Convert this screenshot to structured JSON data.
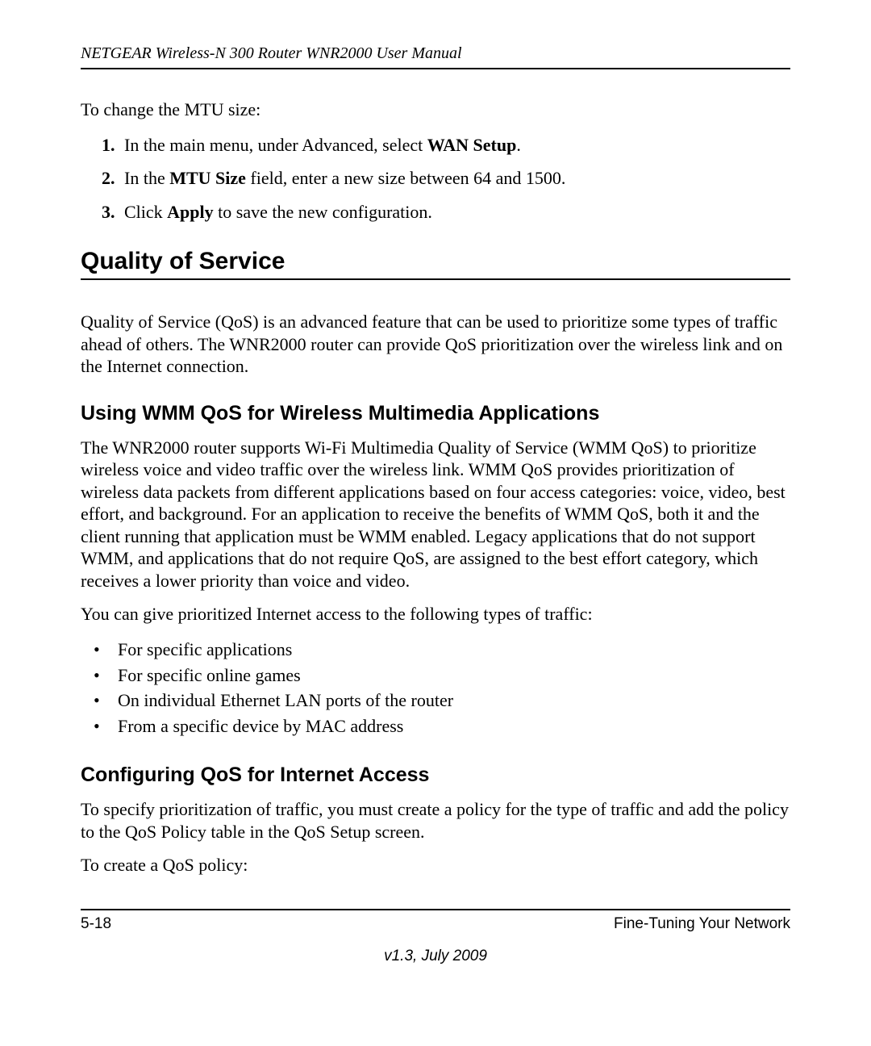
{
  "header": {
    "running_title": "NETGEAR Wireless-N 300 Router WNR2000 User Manual"
  },
  "intro": {
    "mtu_lead": "To change the MTU size:"
  },
  "steps": {
    "s1_pre": "In the main menu, under Advanced, select ",
    "s1_bold": "WAN Setup",
    "s1_post": ".",
    "s2_pre": "In the ",
    "s2_bold": "MTU Size",
    "s2_post": " field, enter a new size between 64 and 1500.",
    "s3_pre": "Click ",
    "s3_bold": "Apply",
    "s3_post": " to save the new configuration."
  },
  "qos": {
    "heading": "Quality of Service",
    "para": "Quality of Service (QoS) is an advanced feature that can be used to prioritize some types of traffic ahead of others. The WNR2000 router can provide QoS prioritization over the wireless link and on the Internet connection."
  },
  "wmm": {
    "heading": "Using WMM QoS for Wireless Multimedia Applications",
    "para1": "The WNR2000 router supports Wi-Fi Multimedia Quality of Service (WMM QoS) to prioritize wireless voice and video traffic over the wireless link. WMM QoS provides prioritization of wireless data packets from different applications based on four access categories: voice, video, best effort, and background. For an application to receive the benefits of WMM QoS, both it and the client running that application must be WMM enabled. Legacy applications that do not support WMM, and applications that do not require QoS, are assigned to the best effort category, which receives a lower priority than voice and video.",
    "para2": "You can give prioritized Internet access to the following types of traffic:",
    "bullets": [
      "For specific applications",
      "For specific online games",
      "On individual Ethernet LAN ports of the router",
      "From a specific device by MAC address"
    ]
  },
  "configqos": {
    "heading": "Configuring QoS for Internet Access",
    "para1": "To specify prioritization of traffic, you must create a policy for the type of traffic and add the policy to the QoS Policy table in the QoS Setup screen.",
    "para2": "To create a QoS policy:"
  },
  "footer": {
    "page_number": "5-18",
    "section_name": "Fine-Tuning Your Network",
    "version": "v1.3, July 2009"
  }
}
